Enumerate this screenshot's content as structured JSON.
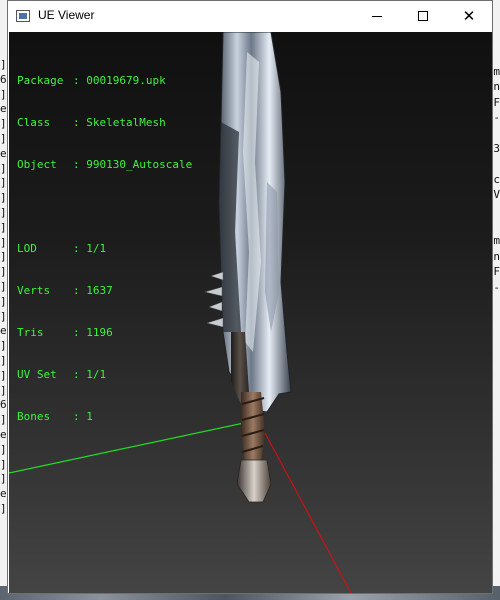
{
  "window": {
    "title": "UE Viewer",
    "app_icon": "window-app-icon",
    "controls": [
      "minimize-icon",
      "maximize-icon",
      "close-icon"
    ]
  },
  "info": {
    "package_label": "Package",
    "package_value": "00019679.upk",
    "class_label": "Class",
    "class_value": "SkeletalMesh",
    "object_label": "Object",
    "object_value": "990130_Autoscale",
    "lod_label": "LOD",
    "lod_value": "1/1",
    "verts_label": "Verts",
    "verts_value": "1637",
    "tris_label": "Tris",
    "tris_value": "1196",
    "uvset_label": "UV Set",
    "uvset_value": "1/1",
    "bones_label": "Bones",
    "bones_value": "1"
  },
  "colors": {
    "info_text": "#3ff13f",
    "axis_green": "#22dd22",
    "axis_red": "#cc1111"
  },
  "background_left_glyphs": [
    "]",
    "6",
    "]",
    "e",
    "]",
    "]",
    "e",
    "]",
    "]",
    "]",
    "]",
    "]",
    "]",
    "]",
    "]",
    "]",
    "]",
    "]",
    "e",
    "]",
    "]",
    "]",
    "]",
    "6",
    "]",
    "e",
    "]",
    "]",
    "]",
    "e",
    "]"
  ],
  "background_right_glyphs": [
    "m",
    "n",
    "F",
    "-",
    "",
    "3",
    "",
    "c",
    "V",
    "",
    "",
    "m",
    "n",
    "F",
    "-"
  ]
}
